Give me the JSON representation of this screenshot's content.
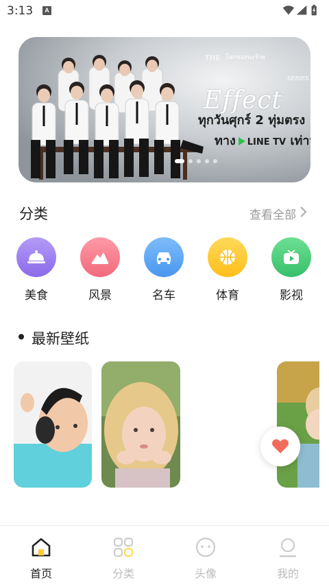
{
  "status_bar": {
    "time": "3:13",
    "notification_letter": "A",
    "icons": [
      "wifi-icon",
      "signal-icon",
      "battery-icon"
    ]
  },
  "banner": {
    "brand_small": "THE",
    "thai_top": "โลกของนะร้าย",
    "title": "Effect",
    "series": "SERIES",
    "line1": "ทุกวันศุกร์ 2 ทุ่มตรง",
    "line2_prefix": "ทาง",
    "line2_channel": "LINE TV",
    "line2_suffix": "เท่านั้น",
    "page_count": 5,
    "active_page": 1
  },
  "categories": {
    "title": "分类",
    "more_label": "查看全部",
    "items": [
      {
        "label": "美食",
        "icon": "food-cloche-icon",
        "color": "#9b7cf0"
      },
      {
        "label": "风景",
        "icon": "landscape-icon",
        "color": "#f77d8e"
      },
      {
        "label": "名车",
        "icon": "car-icon",
        "color": "#5ca8f6"
      },
      {
        "label": "体育",
        "icon": "basketball-icon",
        "color": "#ffcb2e"
      },
      {
        "label": "影视",
        "icon": "tv-icon",
        "color": "#4ccc7a"
      }
    ]
  },
  "latest": {
    "title": "最新壁纸"
  },
  "bottom_nav": {
    "items": [
      {
        "label": "首页",
        "icon": "home-icon",
        "active": true
      },
      {
        "label": "分类",
        "icon": "grid-icon",
        "active": false
      },
      {
        "label": "头像",
        "icon": "avatar-face-icon",
        "active": false
      },
      {
        "label": "我的",
        "icon": "profile-icon",
        "active": false
      }
    ]
  },
  "colors": {
    "accent": "#ffcb2e",
    "heart": "#f36b5a"
  }
}
